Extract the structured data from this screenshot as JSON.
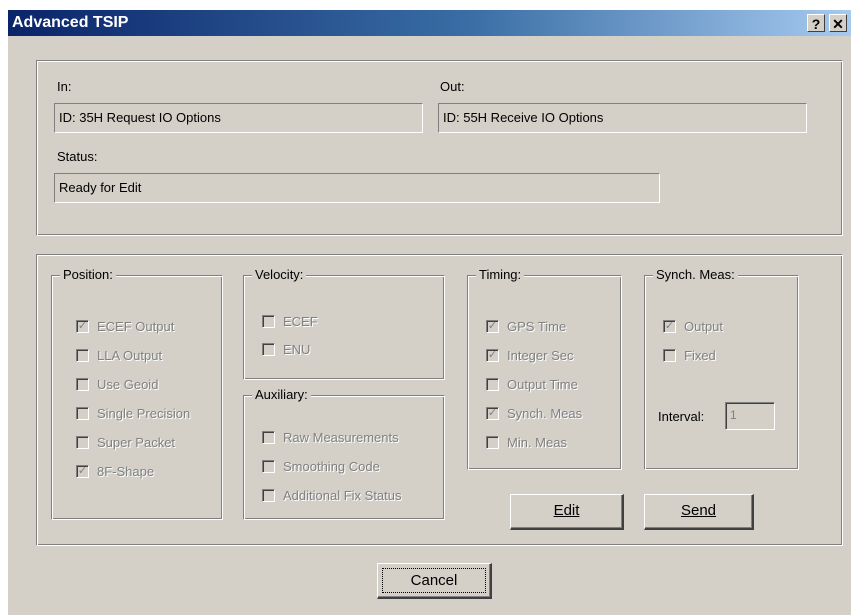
{
  "window": {
    "title": "Advanced TSIP",
    "help_glyph": "?",
    "close_glyph": "✕"
  },
  "io": {
    "in_label": "In:",
    "in_value": "ID: 35H Request IO Options",
    "out_label": "Out:",
    "out_value": "ID: 55H Receive IO Options",
    "status_label": "Status:",
    "status_value": "Ready for Edit"
  },
  "position": {
    "label": "Position:",
    "items": [
      {
        "label": "ECEF Output",
        "checked": true
      },
      {
        "label": "LLA Output",
        "checked": false
      },
      {
        "label": "Use Geoid",
        "checked": false
      },
      {
        "label": "Single Precision",
        "checked": false
      },
      {
        "label": "Super Packet",
        "checked": false
      },
      {
        "label": "8F-Shape",
        "checked": true
      }
    ]
  },
  "velocity": {
    "label": "Velocity:",
    "items": [
      {
        "label": "ECEF",
        "checked": false
      },
      {
        "label": "ENU",
        "checked": false
      }
    ]
  },
  "auxiliary": {
    "label": "Auxiliary:",
    "items": [
      {
        "label": "Raw Measurements",
        "checked": false
      },
      {
        "label": "Smoothing Code",
        "checked": false
      },
      {
        "label": "Additional Fix Status",
        "checked": false
      }
    ]
  },
  "timing": {
    "label": "Timing:",
    "items": [
      {
        "label": "GPS Time",
        "checked": true
      },
      {
        "label": "Integer Sec",
        "checked": true
      },
      {
        "label": "Output Time",
        "checked": false
      },
      {
        "label": "Synch. Meas",
        "checked": true
      },
      {
        "label": "Min. Meas",
        "checked": false
      }
    ]
  },
  "synch": {
    "label": "Synch. Meas:",
    "items": [
      {
        "label": "Output",
        "checked": true
      },
      {
        "label": "Fixed",
        "checked": false
      }
    ],
    "interval_label": "Interval:",
    "interval_value": "1"
  },
  "buttons": {
    "edit": "Edit",
    "send": "Send",
    "cancel": "Cancel"
  },
  "colors": {
    "face": "#d4d0c8",
    "title_start": "#0a246a",
    "title_end": "#a6caf0",
    "disabled_text": "#808080"
  }
}
